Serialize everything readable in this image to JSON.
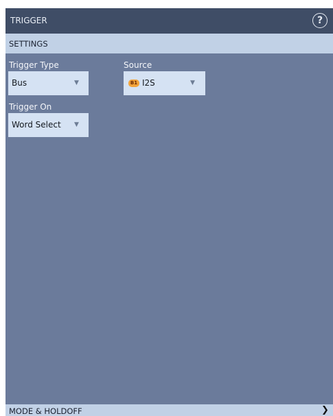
{
  "window": {
    "title": "TRIGGER",
    "help_icon": "?"
  },
  "settings": {
    "header": "SETTINGS",
    "trigger_type": {
      "label": "Trigger Type",
      "value": "Bus"
    },
    "source": {
      "label": "Source",
      "badge": "B1",
      "value": "I2S"
    },
    "trigger_on": {
      "label": "Trigger On",
      "value": "Word Select"
    }
  },
  "footer": {
    "label": "MODE & HOLDOFF",
    "chevron": "❯"
  },
  "icons": {
    "help": "help-icon",
    "dropdown_arrow": "dropdown-arrow-icon",
    "chevron": "chevron-right-icon"
  },
  "colors": {
    "panel_bg": "#6b7b9b",
    "titlebar_bg": "#3f4d66",
    "section_bg": "#c1d1e6",
    "field_bg": "#d5e2f3",
    "badge_bg": "#f2a33a"
  }
}
